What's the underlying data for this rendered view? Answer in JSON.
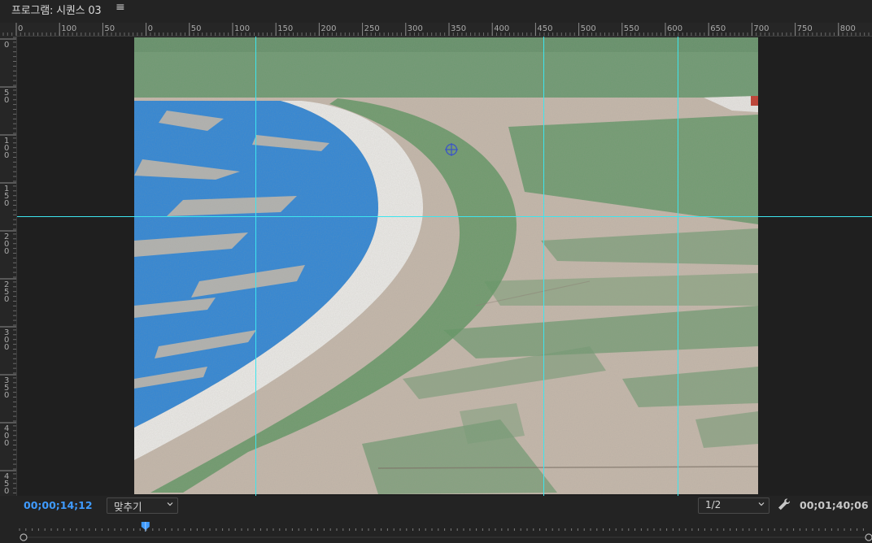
{
  "header": {
    "title": "프로그램: 시퀀스 03",
    "menu_icon": "hamburger-menu-icon"
  },
  "rulers": {
    "horizontal_labels": [
      "0",
      "100",
      "50",
      "0",
      "50",
      "100",
      "150",
      "200",
      "250",
      "300",
      "350",
      "400",
      "450",
      "500",
      "550",
      "600",
      "650",
      "700",
      "750",
      "800"
    ],
    "vertical_labels": [
      "0",
      "50",
      "100",
      "150",
      "200",
      "250",
      "300",
      "350",
      "400",
      "450"
    ]
  },
  "controls": {
    "current_timecode": "00;00;14;12",
    "zoom_value": "맞추기",
    "resolution_value": "1/2",
    "duration_timecode": "00;01;40;06",
    "settings_icon": "wrench-icon"
  },
  "colors": {
    "accent_blue": "#3f9bff",
    "guide_cyan": "#3de6ee",
    "panel_bg": "#232323"
  },
  "playhead_fraction": 0.145
}
